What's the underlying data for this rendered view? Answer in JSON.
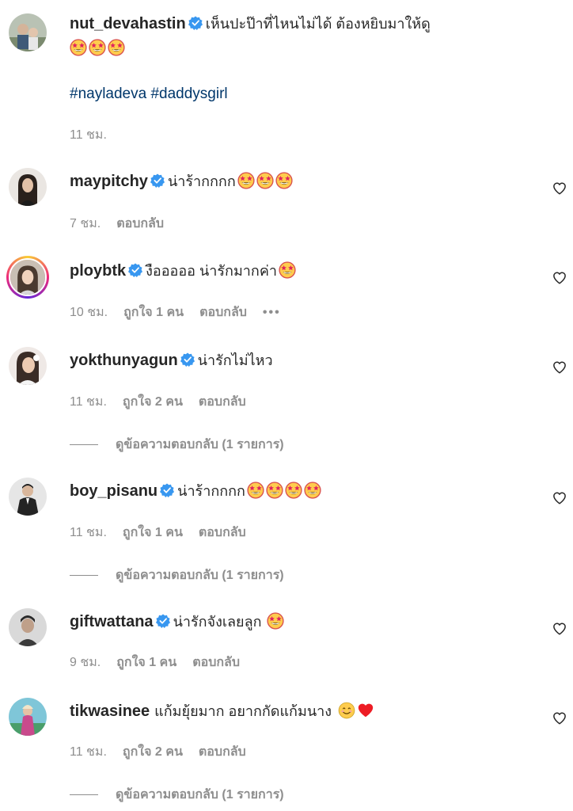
{
  "post": {
    "username": "nut_devahastin",
    "text": "เห็นปะป๊าที่ไหนไม่ได้ ต้องหยิบมาให้ดู",
    "emojis": [
      "star-struck-emoji",
      "star-struck-emoji",
      "star-struck-emoji"
    ],
    "hashtags": "#nayladeva #daddysgirl",
    "time": "11 ชม."
  },
  "comments": [
    {
      "username": "maypitchy",
      "verified": true,
      "text": "น่าร้ากกกก",
      "time": "7 ชม.",
      "reply_label": "ตอบกลับ"
    },
    {
      "username": "ploybtk",
      "verified": true,
      "text": "งือออออ น่ารักมากค่า",
      "time": "10 ชม.",
      "likes": "ถูกใจ 1 คน",
      "reply_label": "ตอบกลับ",
      "more": "•••"
    },
    {
      "username": "yokthunyagun",
      "verified": true,
      "text": "น่ารักไม่ไหว",
      "time": "11 ชม.",
      "likes": "ถูกใจ 2 คน",
      "reply_label": "ตอบกลับ",
      "view_replies": "ดูข้อความตอบกลับ (1 รายการ)"
    },
    {
      "username": "boy_pisanu",
      "verified": true,
      "text": "น่าร้ากกกก",
      "time": "11 ชม.",
      "likes": "ถูกใจ 1 คน",
      "reply_label": "ตอบกลับ",
      "view_replies": "ดูข้อความตอบกลับ (1 รายการ)"
    },
    {
      "username": "giftwattana",
      "verified": true,
      "text": "น่ารักจังเลยลูก",
      "time": "9 ชม.",
      "likes": "ถูกใจ 1 คน",
      "reply_label": "ตอบกลับ"
    },
    {
      "username": "tikwasinee",
      "verified": false,
      "text": "แก้มยุ้ยมาก อยากกัดแก้มนาง",
      "time": "11 ชม.",
      "likes": "ถูกใจ 2 คน",
      "reply_label": "ตอบกลับ",
      "view_replies": "ดูข้อความตอบกลับ (1 รายการ)"
    }
  ],
  "icons": {
    "like": "heart-outline-icon",
    "verified": "verified-badge-icon"
  },
  "colors": {
    "verified": "#3897f0",
    "hashtag": "#00376b",
    "secondary_text": "#8e8e8e",
    "primary_text": "#262626",
    "heart_red": "#ed1c24"
  }
}
